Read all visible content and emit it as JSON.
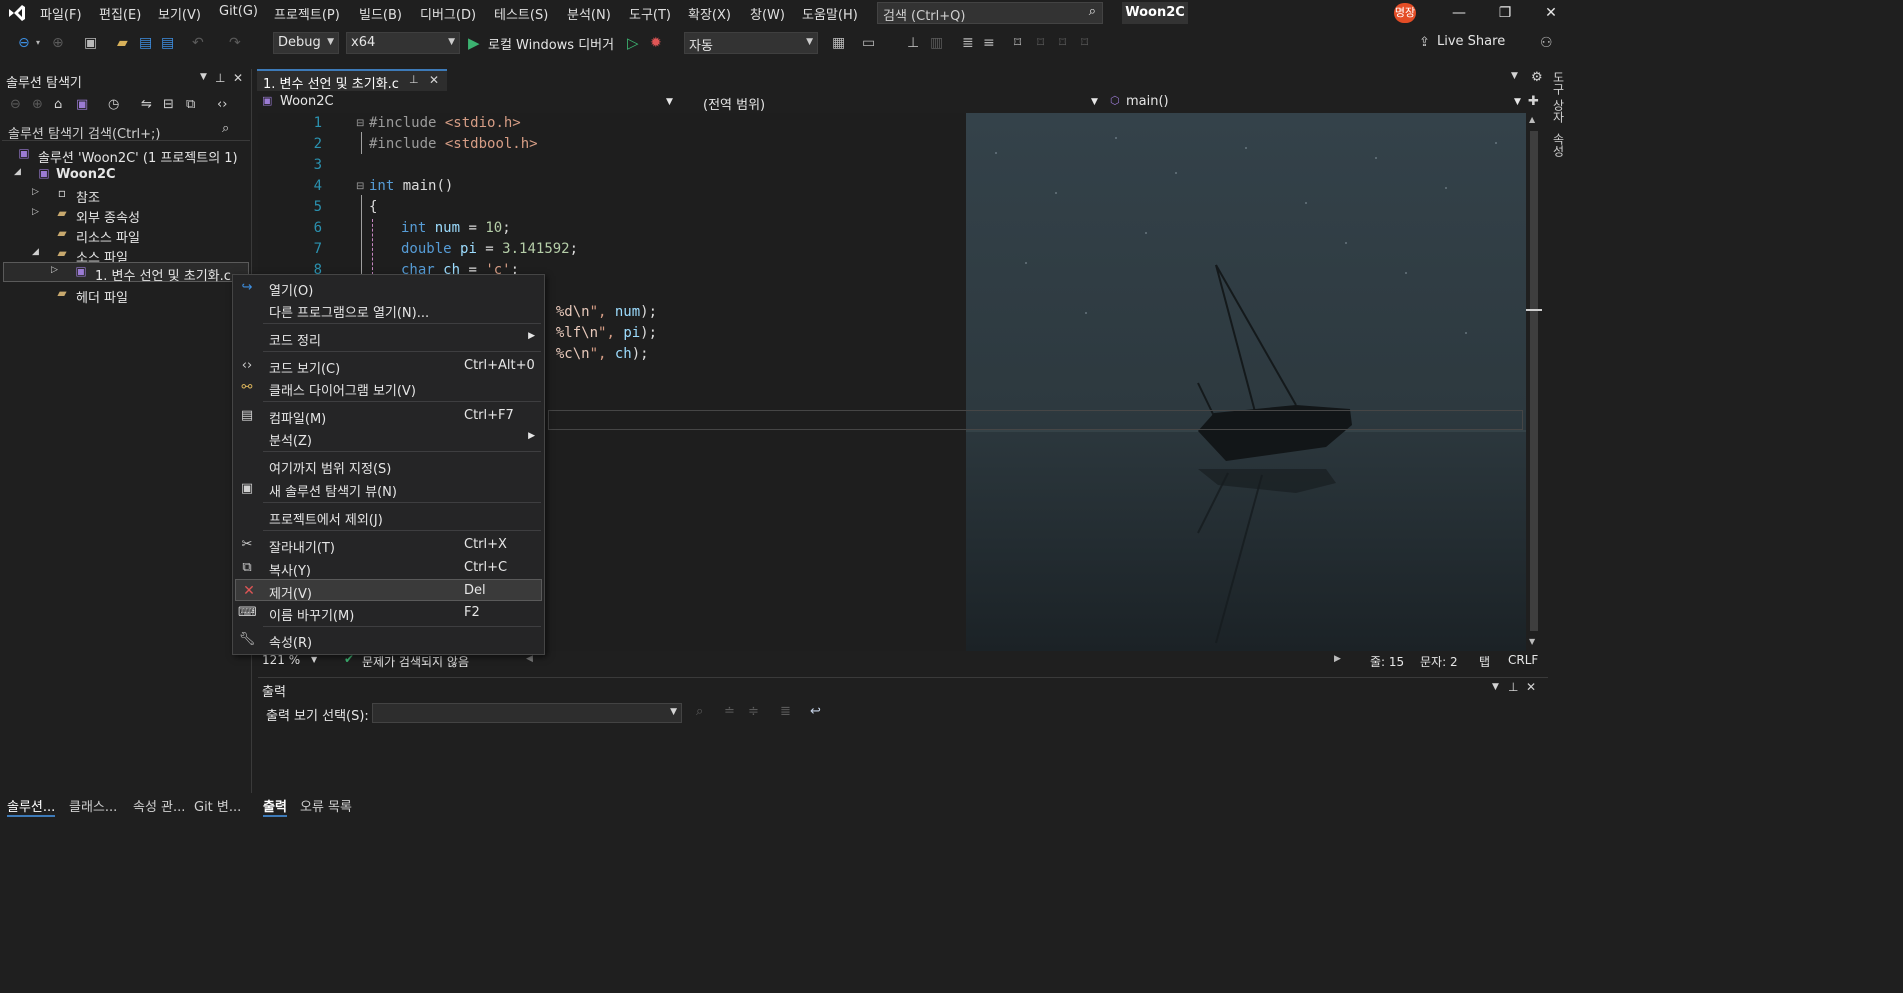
{
  "menu": [
    "파일(F)",
    "편집(E)",
    "보기(V)",
    "Git(G)",
    "프로젝트(P)",
    "빌드(B)",
    "디버그(D)",
    "테스트(S)",
    "분석(N)",
    "도구(T)",
    "확장(X)",
    "창(W)",
    "도움말(H)"
  ],
  "search": {
    "placeholder": "검색 (Ctrl+Q)"
  },
  "title_badge": "Woon2C",
  "avatar": "명장",
  "toolbar": {
    "config": "Debug",
    "platform": "x64",
    "debugger": "로컬 Windows 디버거",
    "auto": "자동",
    "live_share": "Live Share"
  },
  "solution_explorer": {
    "title": "솔루션 탐색기",
    "search_placeholder": "솔루션 탐색기 검색(Ctrl+;)",
    "tree": [
      {
        "label": "솔루션 'Woon2C' (1 프로젝트의 1)"
      },
      {
        "label": "Woon2C"
      },
      {
        "label": "참조"
      },
      {
        "label": "외부 종속성"
      },
      {
        "label": "리소스 파일"
      },
      {
        "label": "소스 파일"
      },
      {
        "label": "1. 변수 선언 및 초기화.c"
      },
      {
        "label": "헤더 파일"
      }
    ]
  },
  "editor": {
    "tab_label": "1. 변수 선언 및 초기화.c",
    "nav_project": "Woon2C",
    "nav_scope": "(전역 범위)",
    "nav_member": "main()",
    "line_numbers": [
      "1",
      "2",
      "3",
      "4",
      "5",
      "6",
      "7",
      "8"
    ],
    "code": {
      "l1": {
        "directive": "#include",
        "header": "<stdio.h>"
      },
      "l2": {
        "directive": "#include",
        "header": "<stdbool.h>"
      },
      "l4": {
        "type": "int",
        "name": "main()"
      },
      "l5": "{",
      "l6": {
        "type": "int",
        "name": "num",
        "op": " = ",
        "value": "10",
        "end": ";"
      },
      "l7": {
        "type": "double",
        "name": "pi",
        "op": " = ",
        "value": "3.141592",
        "end": ";"
      },
      "l8": {
        "type": "char",
        "name": "ch",
        "op": " = ",
        "value": "'c'",
        "end": ";"
      },
      "l10": {
        "pre": ": ",
        "fmt": "%d",
        "esc": "\\n",
        "post": "\", ",
        "arg": "num",
        "end": ");"
      },
      "l11": {
        "pre": ": ",
        "fmt": "%lf",
        "esc": "\\n",
        "post": "\", ",
        "arg": "pi",
        "end": ");"
      },
      "l12": {
        "pre": ": ",
        "fmt": "%c",
        "esc": "\\n",
        "post": "\", ",
        "arg": "ch",
        "end": ");"
      }
    },
    "zoom": "121 %",
    "issues": "문제가 검색되지 않음",
    "line": "줄: 15",
    "col": "문자: 2",
    "tab": "탭",
    "eol": "CRLF"
  },
  "context_menu": [
    {
      "label": "열기(O)",
      "shortcut": "",
      "icon": "open-icon"
    },
    {
      "label": "다른 프로그램으로 열기(N)...",
      "shortcut": ""
    },
    {
      "label": "코드 정리",
      "shortcut": "",
      "submenu": true
    },
    {
      "label": "코드 보기(C)",
      "shortcut": "Ctrl+Alt+0",
      "icon": "code-icon"
    },
    {
      "label": "클래스 다이어그램 보기(V)",
      "shortcut": "",
      "icon": "class-diagram-icon"
    },
    {
      "label": "컴파일(M)",
      "shortcut": "Ctrl+F7",
      "icon": "compile-icon"
    },
    {
      "label": "분석(Z)",
      "shortcut": "",
      "submenu": true
    },
    {
      "label": "여기까지 범위 지정(S)",
      "shortcut": ""
    },
    {
      "label": "새 솔루션 탐색기 뷰(N)",
      "shortcut": "",
      "icon": "new-view-icon"
    },
    {
      "label": "프로젝트에서 제외(J)",
      "shortcut": ""
    },
    {
      "label": "잘라내기(T)",
      "shortcut": "Ctrl+X",
      "icon": "cut-icon"
    },
    {
      "label": "복사(Y)",
      "shortcut": "Ctrl+C",
      "icon": "copy-icon"
    },
    {
      "label": "제거(V)",
      "shortcut": "Del",
      "icon": "delete-icon"
    },
    {
      "label": "이름 바꾸기(M)",
      "shortcut": "F2",
      "icon": "rename-icon"
    },
    {
      "label": "속성(R)",
      "shortcut": "",
      "icon": "wrench-icon"
    }
  ],
  "output": {
    "title": "출력",
    "select_label": "출력 보기 선택(S):"
  },
  "bottom_tabs_left": [
    "솔루션...",
    "클래스...",
    "속성 관...",
    "Git 변..."
  ],
  "bottom_tabs_right": [
    "출력",
    "오류 목록"
  ],
  "right_strip": {
    "toolbox": "도구 상자",
    "properties": "속성"
  },
  "colors": {
    "accent": "#3d7ab8",
    "keyword": "#569cd6",
    "string": "#d69d85",
    "delete": "#e05555"
  }
}
